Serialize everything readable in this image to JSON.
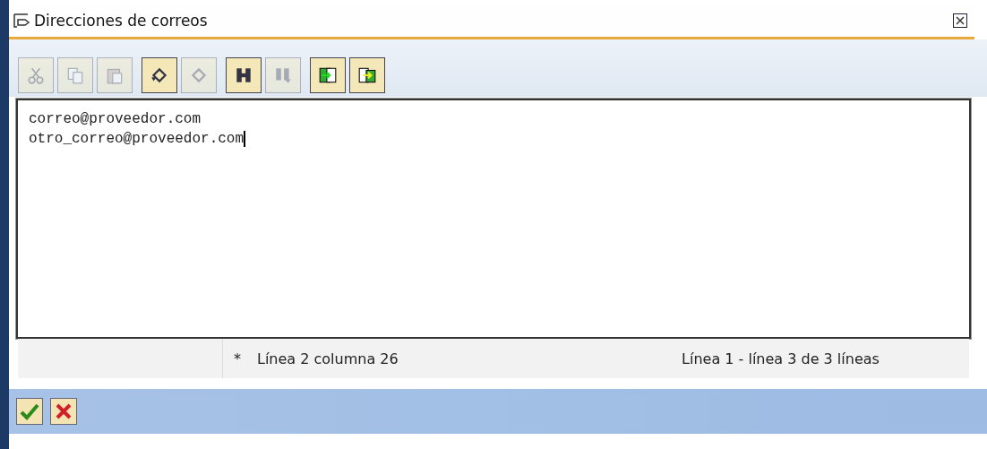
{
  "window": {
    "title": "Direcciones de correos"
  },
  "toolbar": [
    [
      {
        "kind": "cut",
        "disabled": true
      },
      {
        "kind": "copy",
        "disabled": true
      },
      {
        "kind": "paste",
        "disabled": true
      }
    ],
    [
      {
        "kind": "undo",
        "disabled": false
      },
      {
        "kind": "redo",
        "disabled": true
      }
    ],
    [
      {
        "kind": "find",
        "disabled": false
      },
      {
        "kind": "find_next",
        "disabled": true
      }
    ],
    [
      {
        "kind": "import",
        "disabled": false
      },
      {
        "kind": "export",
        "disabled": false
      }
    ]
  ],
  "editor": {
    "lines": [
      {
        "text": "correo@proveedor.com",
        "has_cursor": false
      },
      {
        "text": "otro_correo@proveedor.com",
        "has_cursor": true
      }
    ]
  },
  "status_bar": {
    "modified": "*",
    "position": "Línea 2 columna 26",
    "range": "Línea 1 - línea 3 de 3 líneas"
  },
  "buttons": [
    {
      "kind": "confirm"
    },
    {
      "kind": "cancel"
    }
  ]
}
